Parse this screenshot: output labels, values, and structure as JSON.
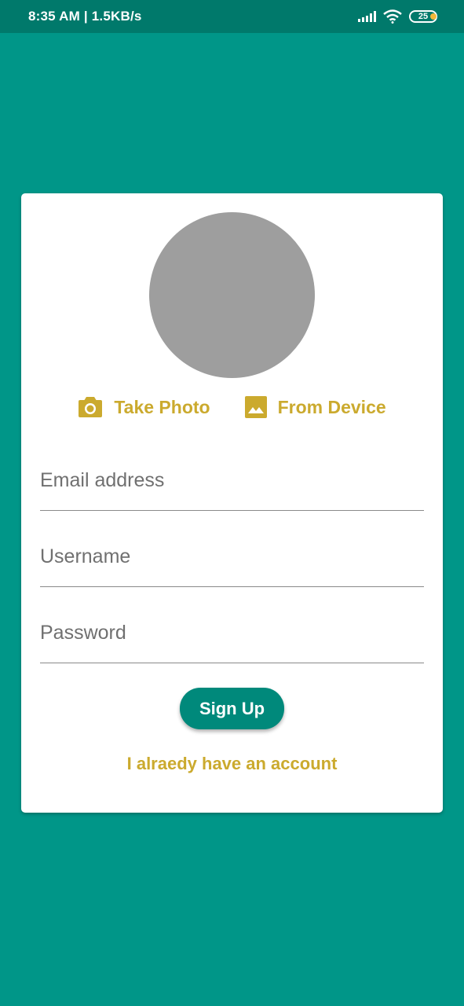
{
  "status_bar": {
    "time_speed": "8:35 AM | 1.5KB/s",
    "battery_level": "25",
    "battery_color": "#f3b73a"
  },
  "profile": {
    "avatar_color": "#9e9e9e",
    "take_photo_label": "Take Photo",
    "from_device_label": "From Device",
    "accent_color": "#cbaa2e"
  },
  "form": {
    "email_placeholder": "Email address",
    "username_placeholder": "Username",
    "password_placeholder": "Password",
    "signup_label": "Sign Up",
    "have_account_label": "I alraedy have an account"
  },
  "theme": {
    "background": "#009688",
    "primary": "#00897b"
  }
}
